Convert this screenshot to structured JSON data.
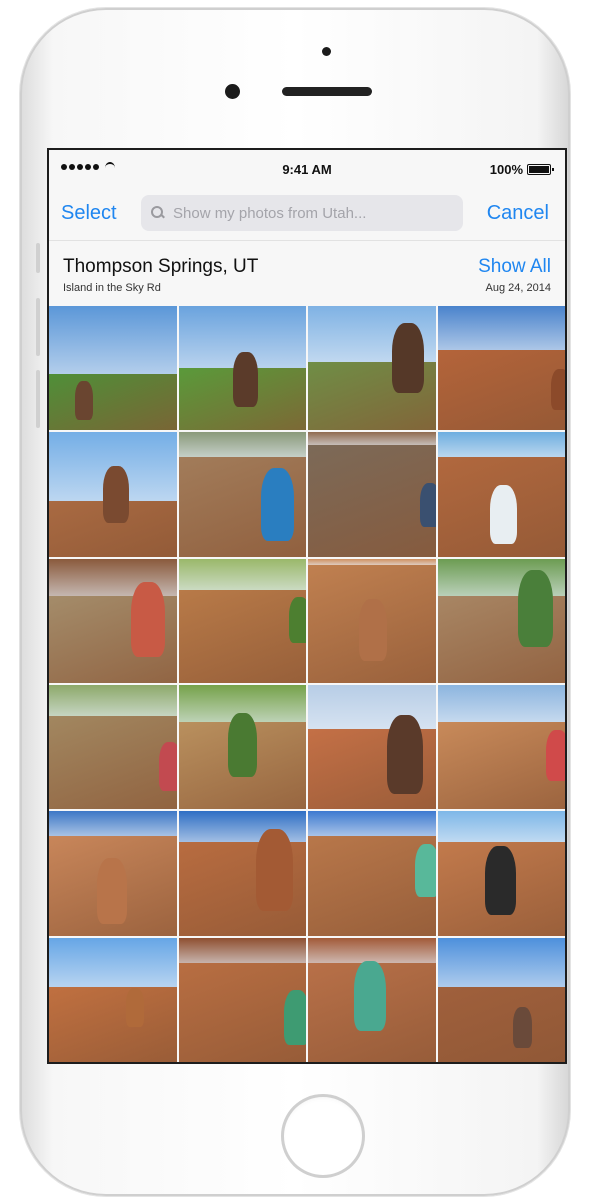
{
  "status_bar": {
    "time": "9:41 AM",
    "battery": "100%"
  },
  "nav": {
    "select_label": "Select",
    "search_placeholder": "Show my photos from Utah...",
    "cancel_label": "Cancel"
  },
  "section": {
    "title": "Thompson Springs, UT",
    "subtitle": "Island in the Sky Rd",
    "show_all_label": "Show All",
    "date": "Aug 24, 2014"
  },
  "colors": {
    "accent": "#1f86f0",
    "sky": "#4f8fd8",
    "sandstone": "#c77a4a",
    "grass": "#5d9b3a"
  },
  "photos": [
    {
      "sky": "#5b97d8",
      "land": "#4f8f38",
      "fig": "#6a4530",
      "skyH": 55
    },
    {
      "sky": "#6aa3de",
      "land": "#5a9a3a",
      "fig": "#5b3b2a",
      "skyH": 50
    },
    {
      "sky": "#7fb2e4",
      "land": "#6f8e46",
      "fig": "#553828",
      "skyH": 45
    },
    {
      "sky": "#4a83cc",
      "land": "#b4643a",
      "fig": "#8c4a2a",
      "skyH": 35
    },
    {
      "sky": "#74aee6",
      "land": "#a96a42",
      "fig": "#7a4a30",
      "skyH": 55
    },
    {
      "sky": "#8a9a7a",
      "land": "#a27c5a",
      "fig": "#2a7ec0",
      "skyH": 20
    },
    {
      "sky": "#8f6b50",
      "land": "#7c6a58",
      "fig": "#3a5070",
      "skyH": 10
    },
    {
      "sky": "#6eaee0",
      "land": "#b1683e",
      "fig": "#e8eef2",
      "skyH": 20
    },
    {
      "sky": "#8a5a3c",
      "land": "#a48c6a",
      "fig": "#c85a45",
      "skyH": 30
    },
    {
      "sky": "#9ab86a",
      "land": "#b87a48",
      "fig": "#4d7f30",
      "skyH": 25
    },
    {
      "sky": "#cf9060",
      "land": "#c08050",
      "fig": "#b07048",
      "skyH": 5
    },
    {
      "sky": "#6c9c52",
      "land": "#a88664",
      "fig": "#4a7f3a",
      "skyH": 30
    },
    {
      "sky": "#8da96a",
      "land": "#a28760",
      "fig": "#c24a50",
      "skyH": 25
    },
    {
      "sky": "#76a24a",
      "land": "#b9905e",
      "fig": "#4a7a32",
      "skyH": 30
    },
    {
      "sky": "#b7cde6",
      "land": "#c47046",
      "fig": "#5a3a2a",
      "skyH": 35
    },
    {
      "sky": "#8cb5df",
      "land": "#c88a5a",
      "fig": "#d04a4a",
      "skyH": 30
    },
    {
      "sky": "#3d78c6",
      "land": "#c8865a",
      "fig": "#b8744a",
      "skyH": 20
    },
    {
      "sky": "#2f6fc4",
      "land": "#b86c40",
      "fig": "#a35a34",
      "skyH": 25
    },
    {
      "sky": "#3d7ad0",
      "land": "#b8774a",
      "fig": "#58b89a",
      "skyH": 20
    },
    {
      "sky": "#7eb7e8",
      "land": "#c27a4c",
      "fig": "#2a2a2a",
      "skyH": 25
    },
    {
      "sky": "#66a6e6",
      "land": "#c07040",
      "fig": "#b06a3a",
      "skyH": 40
    },
    {
      "sky": "#8f4f30",
      "land": "#b86e42",
      "fig": "#3e9b72",
      "skyH": 20
    },
    {
      "sky": "#a25a38",
      "land": "#b87048",
      "fig": "#4aa890",
      "skyH": 20
    },
    {
      "sky": "#4d90dc",
      "land": "#a0603c",
      "fig": "#6a4a3a",
      "skyH": 40
    }
  ]
}
